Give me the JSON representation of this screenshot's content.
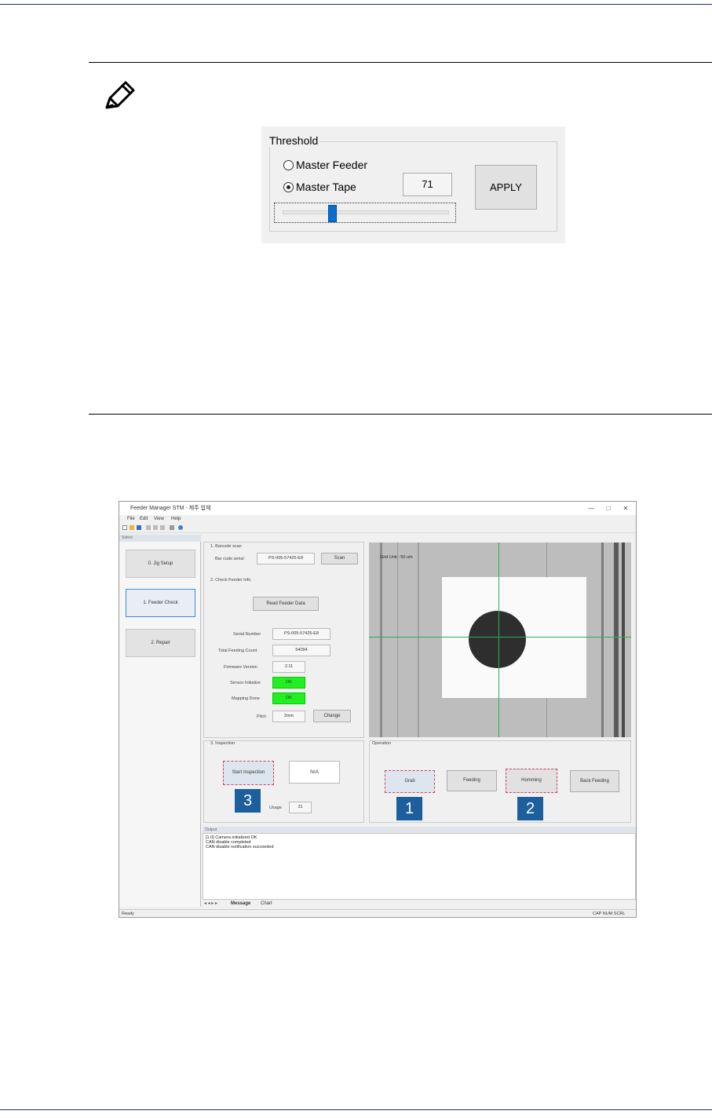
{
  "threshold_panel": {
    "title": "Threshold",
    "option_master_feeder": "Master Feeder",
    "option_master_tape": "Master Tape",
    "selected_option": "Master Tape",
    "value": "71",
    "apply_label": "APPLY",
    "slider_level_percent": 30
  },
  "app": {
    "window_title": "Feeder Manager STM - 제주 업체",
    "menu": [
      "File",
      "Edit",
      "View",
      "Help"
    ],
    "left_pane_title": "Select",
    "left_buttons": [
      "0. Jig Setup",
      "1. Feeder Check",
      "2. Repair"
    ],
    "section_barcode": "1. Barcode scan",
    "barcode_label": "Bar code serial",
    "barcode_value": "PS-005-57425-E8",
    "scan_label": "Scan",
    "section_check": "2. Check Feeder Info.",
    "read_feeder_label": "Read Feeder Data",
    "serial_label": "Serial Number",
    "serial_value": "PS-005-57425-E8",
    "feeding_count_label": "Total Feeding Count",
    "feeding_count_value": "54094",
    "firmware_label": "Firmware Version",
    "firmware_value": "2.11",
    "sensor_label": "Sensor Initialize",
    "sensor_value": "OK",
    "mapping_label": "Mapping Done",
    "mapping_value": "OK",
    "pitch_label": "Pitch",
    "pitch_value": "2mm",
    "change_label": "Change",
    "grid_unit": "Grid Unit : 50 um",
    "section_inspection": "3. Inspection",
    "start_inspection_label": "Start Inspection",
    "result_value": "N/A",
    "usage_label": "Usage",
    "usage_value": "31",
    "section_operation": "Operation",
    "grab_label": "Grab",
    "feeding_label": "Feeding",
    "homming_label": "Homming",
    "back_feeding_label": "Back Feeding",
    "output_title": "Output",
    "output_lines": [
      "[1.0] Camera initialized OK",
      "CAN disable completed",
      "CAN disable notification succeeded"
    ],
    "tabs": [
      "Message",
      "Chart"
    ],
    "status_left": "Ready",
    "status_right": "CAP  NUM  SCRL"
  },
  "badges": [
    "1",
    "2",
    "3"
  ]
}
